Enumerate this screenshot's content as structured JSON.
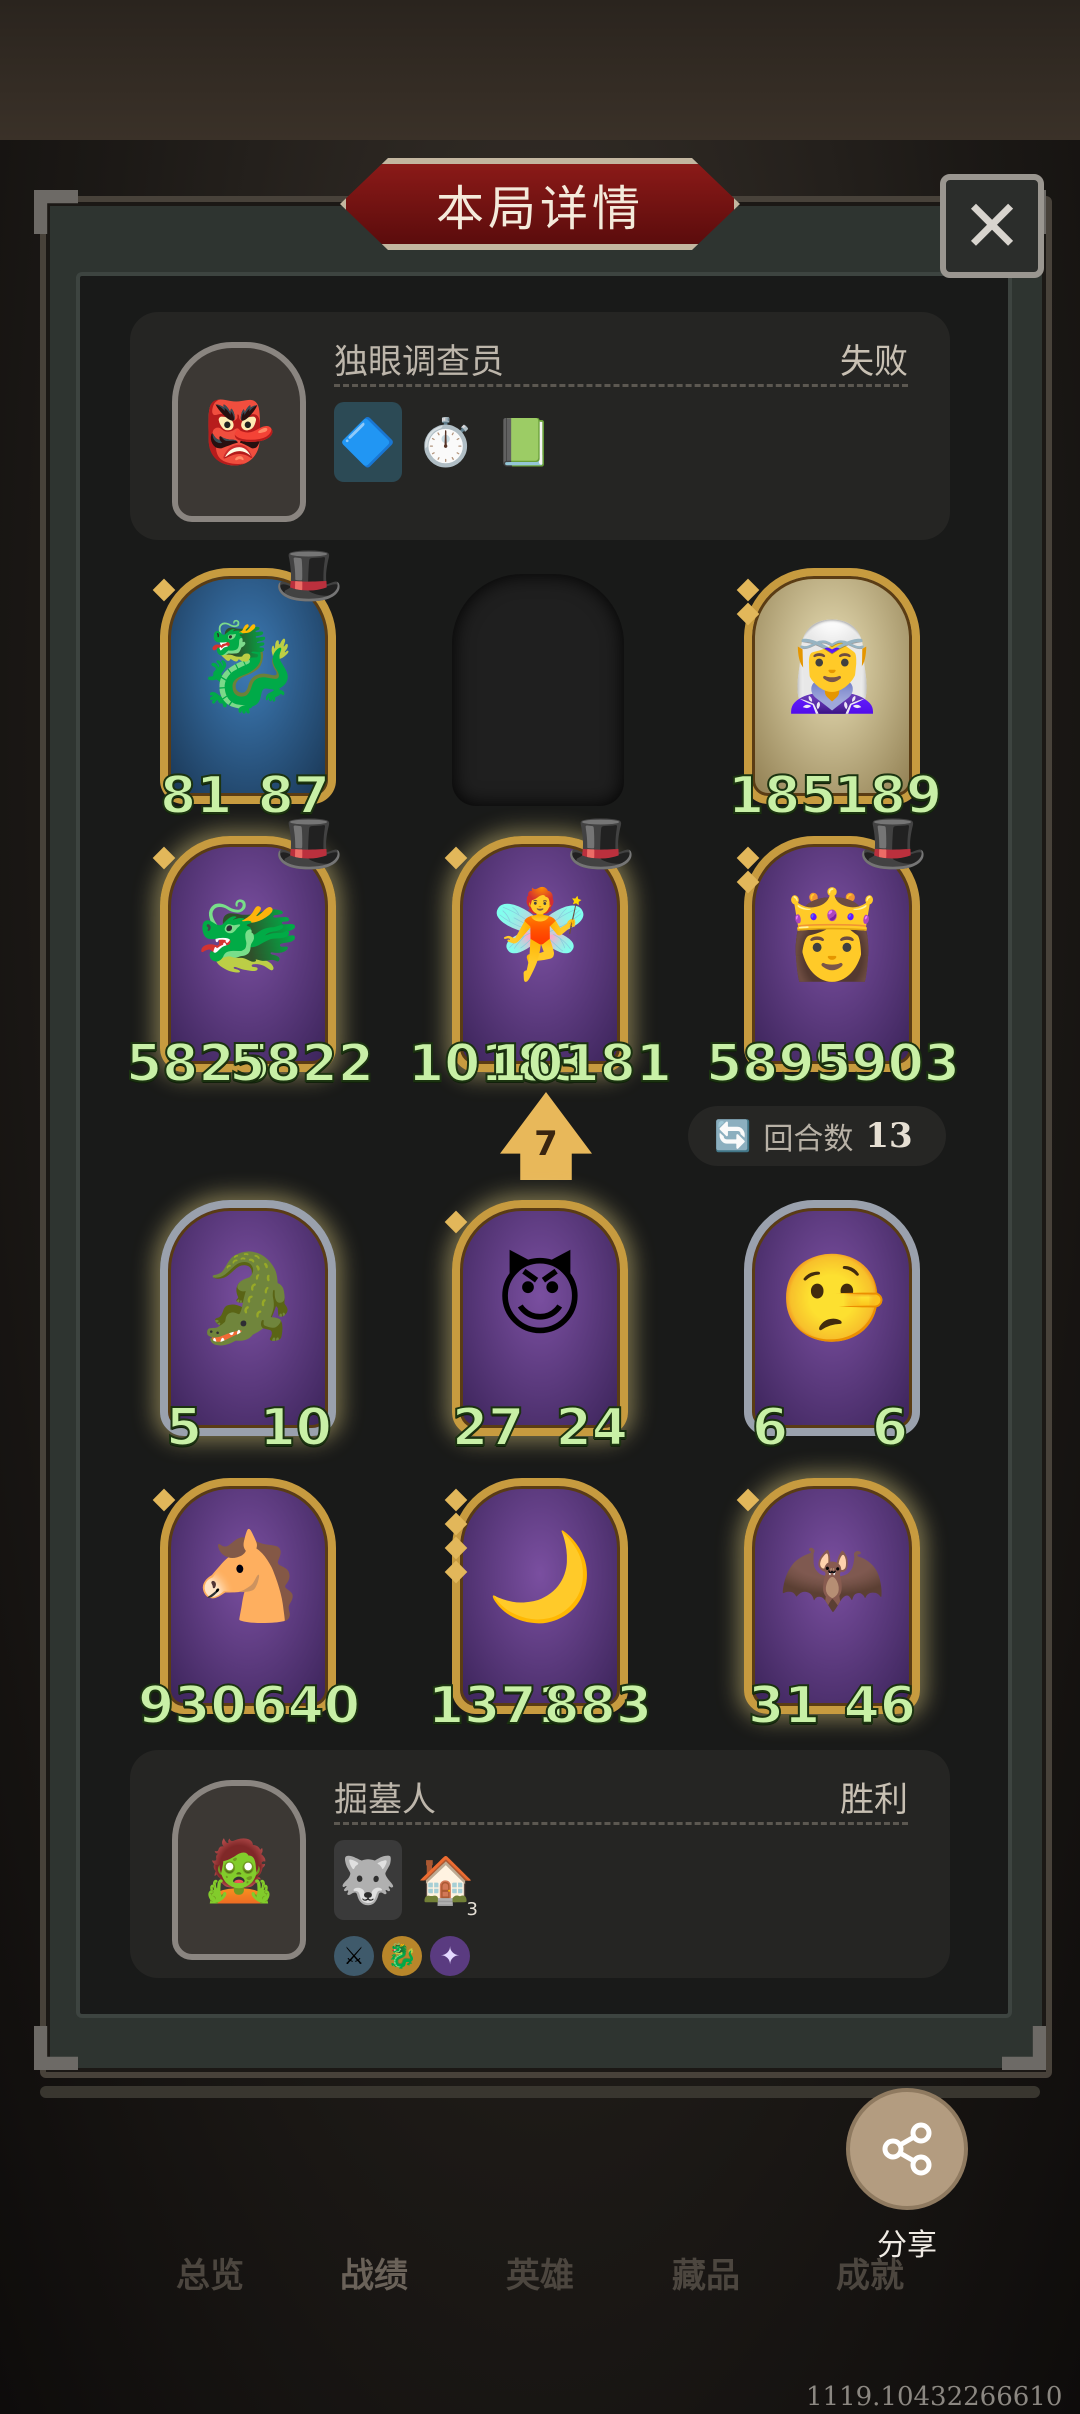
{
  "title": "本局详情",
  "close_icon": "✕",
  "top_player": {
    "name": "独眼调查员",
    "result": "失败",
    "avatar_icon": "👺",
    "items": [
      "🔷",
      "⏱️",
      "📗"
    ]
  },
  "bottom_player": {
    "name": "掘墓人",
    "result": "胜利",
    "avatar_icon": "🧟",
    "items": [
      "🐺",
      "🏠"
    ],
    "item_badge": "3",
    "small_icons": [
      "⚔",
      "🐉",
      "✦"
    ]
  },
  "top_cards": [
    {
      "atk": "81",
      "hp": "87",
      "portrait": "🐉"
    },
    {
      "atk": "185",
      "hp": "189",
      "portrait": "🧝‍♀️"
    },
    {
      "atk": "5825",
      "hp": "5822",
      "portrait": "🐲"
    },
    {
      "atk": "10183",
      "hp": "10181",
      "portrait": "🧚"
    },
    {
      "atk": "5899",
      "hp": "5903",
      "portrait": "👸"
    }
  ],
  "bottom_cards": [
    {
      "atk": "5",
      "hp": "10",
      "portrait": "🐊"
    },
    {
      "atk": "27",
      "hp": "24",
      "portrait": "😈"
    },
    {
      "atk": "6",
      "hp": "6",
      "portrait": "🤥"
    },
    {
      "atk": "930",
      "hp": "640",
      "portrait": "🐴"
    },
    {
      "atk": "1371",
      "hp": "883",
      "portrait": "🌙"
    },
    {
      "atk": "31",
      "hp": "46",
      "portrait": "🦇"
    }
  ],
  "tier": "7",
  "round": {
    "label": "回合数",
    "value": "13",
    "icon": "🔄"
  },
  "share": {
    "label": "分享",
    "icon": "share-icon"
  },
  "tabs": [
    "总览",
    "战绩",
    "英雄",
    "藏品",
    "成就"
  ],
  "footer_id": "1119.10432266610"
}
